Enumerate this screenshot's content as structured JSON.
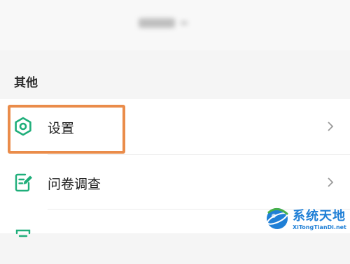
{
  "header": {
    "title": "",
    "chevron_icon": "chevron-down-icon"
  },
  "section": {
    "title": "其他"
  },
  "menu": {
    "items": [
      {
        "label": "设置",
        "icon": "hexagon-settings-icon",
        "highlighted": true
      },
      {
        "label": "问卷调查",
        "icon": "survey-edit-icon"
      },
      {
        "label": "",
        "icon": "list-icon"
      }
    ]
  },
  "annotation": {
    "color": "#ea8c4a"
  },
  "watermark": {
    "title": "系统天地",
    "subtitle": "XiTongTianDi.net"
  },
  "colors": {
    "accent_green": "#1fae7a",
    "watermark_blue": "#1f7fd6"
  }
}
